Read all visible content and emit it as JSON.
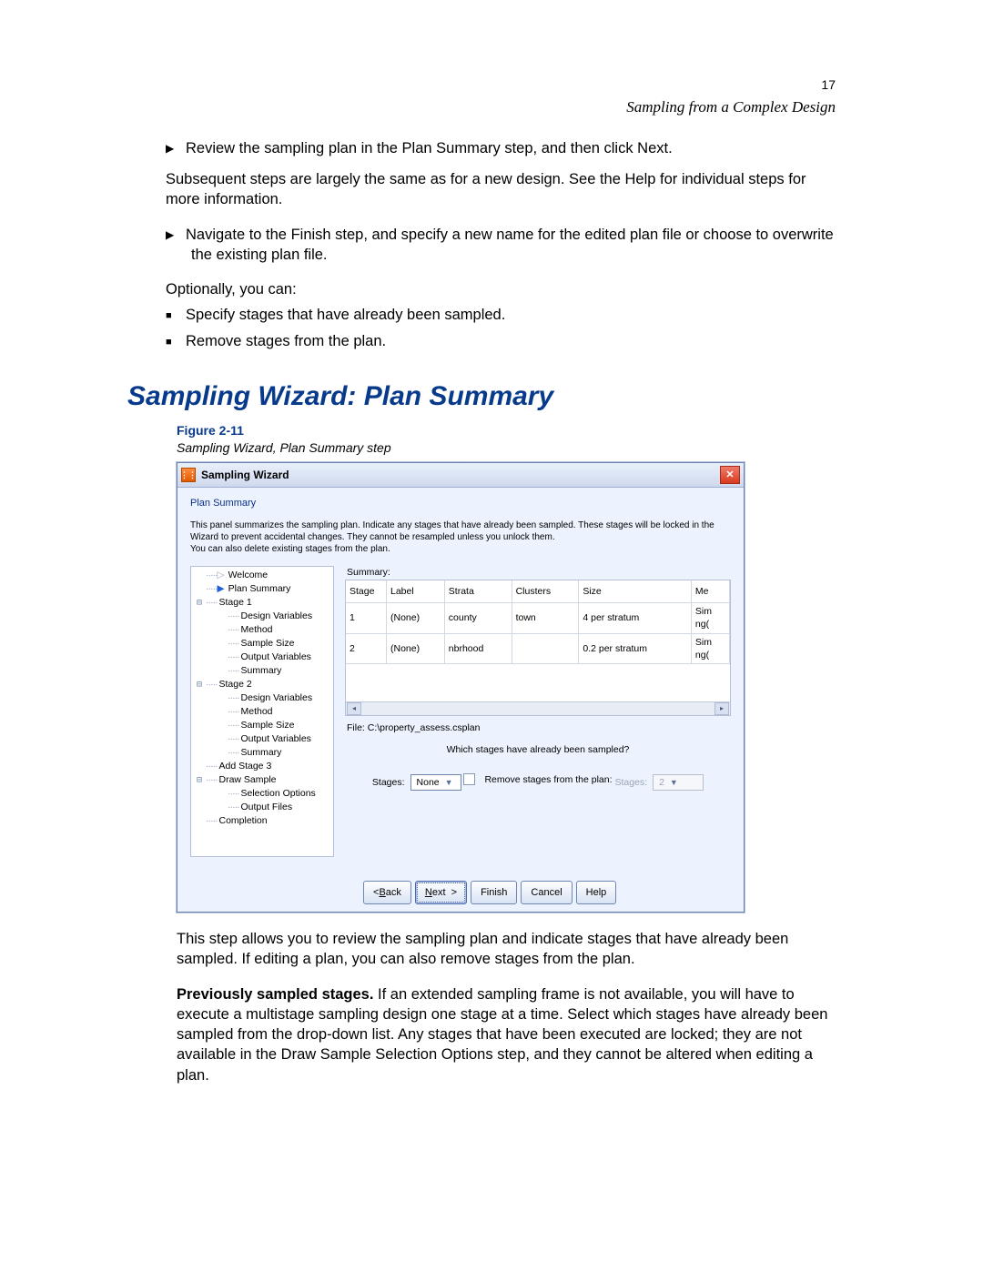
{
  "page_number": "17",
  "section_label": "Sampling from a Complex Design",
  "step1_line": "Review the sampling plan in the Plan Summary step, and then click Next.",
  "step1_follow": "Subsequent steps are largely the same as for a new design. See the Help for individual steps for more information.",
  "step2_line": "Navigate to the Finish step, and specify a new name for the edited plan ﬁle or choose to overwrite the existing plan ﬁle.",
  "optional_intro": "Optionally, you can:",
  "opt_a": "Specify stages that have already been sampled.",
  "opt_b": "Remove stages from the plan.",
  "heading": "Sampling Wizard: Plan Summary",
  "figure_num": "Figure 2-11",
  "figure_title": "Sampling Wizard, Plan Summary step",
  "window": {
    "title": "Sampling Wizard",
    "app_icon_text": "⋮⋮",
    "close_glyph": "✕",
    "pane_title": "Plan Summary",
    "intro": "This panel summarizes the sampling plan. Indicate any stages that have already been sampled. These stages will be locked in the Wizard to prevent accidental changes. They cannot be resampled unless you unlock them.\nYou can also delete existing stages from the plan.",
    "nav": [
      {
        "indent": 0,
        "twist": "",
        "pre": "g",
        "text": "Welcome"
      },
      {
        "indent": 0,
        "twist": "",
        "pre": "a",
        "text": "Plan Summary"
      },
      {
        "indent": 0,
        "twist": "⊟",
        "pre": "",
        "text": "Stage 1"
      },
      {
        "indent": 1,
        "twist": "",
        "pre": "",
        "text": "Design Variables"
      },
      {
        "indent": 1,
        "twist": "",
        "pre": "",
        "text": "Method"
      },
      {
        "indent": 1,
        "twist": "",
        "pre": "",
        "text": "Sample Size"
      },
      {
        "indent": 1,
        "twist": "",
        "pre": "",
        "text": "Output Variables"
      },
      {
        "indent": 1,
        "twist": "",
        "pre": "",
        "text": "Summary"
      },
      {
        "indent": 0,
        "twist": "⊟",
        "pre": "",
        "text": "Stage 2"
      },
      {
        "indent": 1,
        "twist": "",
        "pre": "",
        "text": "Design Variables"
      },
      {
        "indent": 1,
        "twist": "",
        "pre": "",
        "text": "Method"
      },
      {
        "indent": 1,
        "twist": "",
        "pre": "",
        "text": "Sample Size"
      },
      {
        "indent": 1,
        "twist": "",
        "pre": "",
        "text": "Output Variables"
      },
      {
        "indent": 1,
        "twist": "",
        "pre": "",
        "text": "Summary"
      },
      {
        "indent": 0,
        "twist": "",
        "pre": "d",
        "text": "Add Stage 3"
      },
      {
        "indent": 0,
        "twist": "⊟",
        "pre": "",
        "text": "Draw Sample"
      },
      {
        "indent": 1,
        "twist": "",
        "pre": "",
        "text": "Selection Options"
      },
      {
        "indent": 1,
        "twist": "",
        "pre": "",
        "text": "Output Files"
      },
      {
        "indent": 0,
        "twist": "",
        "pre": "d",
        "text": "Completion"
      }
    ],
    "summary_label": "Summary:",
    "columns": [
      "Stage",
      "Label",
      "Strata",
      "Clusters",
      "Size",
      "Me"
    ],
    "rows": [
      {
        "Stage": "1",
        "Label": "(None)",
        "Strata": "county",
        "Clusters": "town",
        "Size": "4 per stratum",
        "Me": "Sim\nng("
      },
      {
        "Stage": "2",
        "Label": "(None)",
        "Strata": "nbrhood",
        "Clusters": "",
        "Size": "0.2 per stratum",
        "Me": "Sim\nng("
      }
    ],
    "file_line": "File:  C:\\property_assess.csplan",
    "question1": "Which stages have already been sampled?",
    "q1_label": "Stages:",
    "q1_value": "None",
    "remove_label": "Remove stages from the plan:",
    "q2_label": "Stages:",
    "q2_value": "2",
    "buttons": {
      "back": "< Back",
      "next": "Next >",
      "finish": "Finish",
      "cancel": "Cancel",
      "help": "Help"
    }
  },
  "after_para1": "This step allows you to review the sampling plan and indicate stages that have already been sampled. If editing a plan, you can also remove stages from the plan.",
  "after_strong": "Previously sampled stages.",
  "after_para2": " If an extended sampling frame is not available, you will have to execute a multistage sampling design one stage at a time. Select which stages have already been sampled from the drop-down list. Any stages that have been executed are locked; they are not available in the Draw Sample Selection Options step, and they cannot be altered when editing a plan."
}
